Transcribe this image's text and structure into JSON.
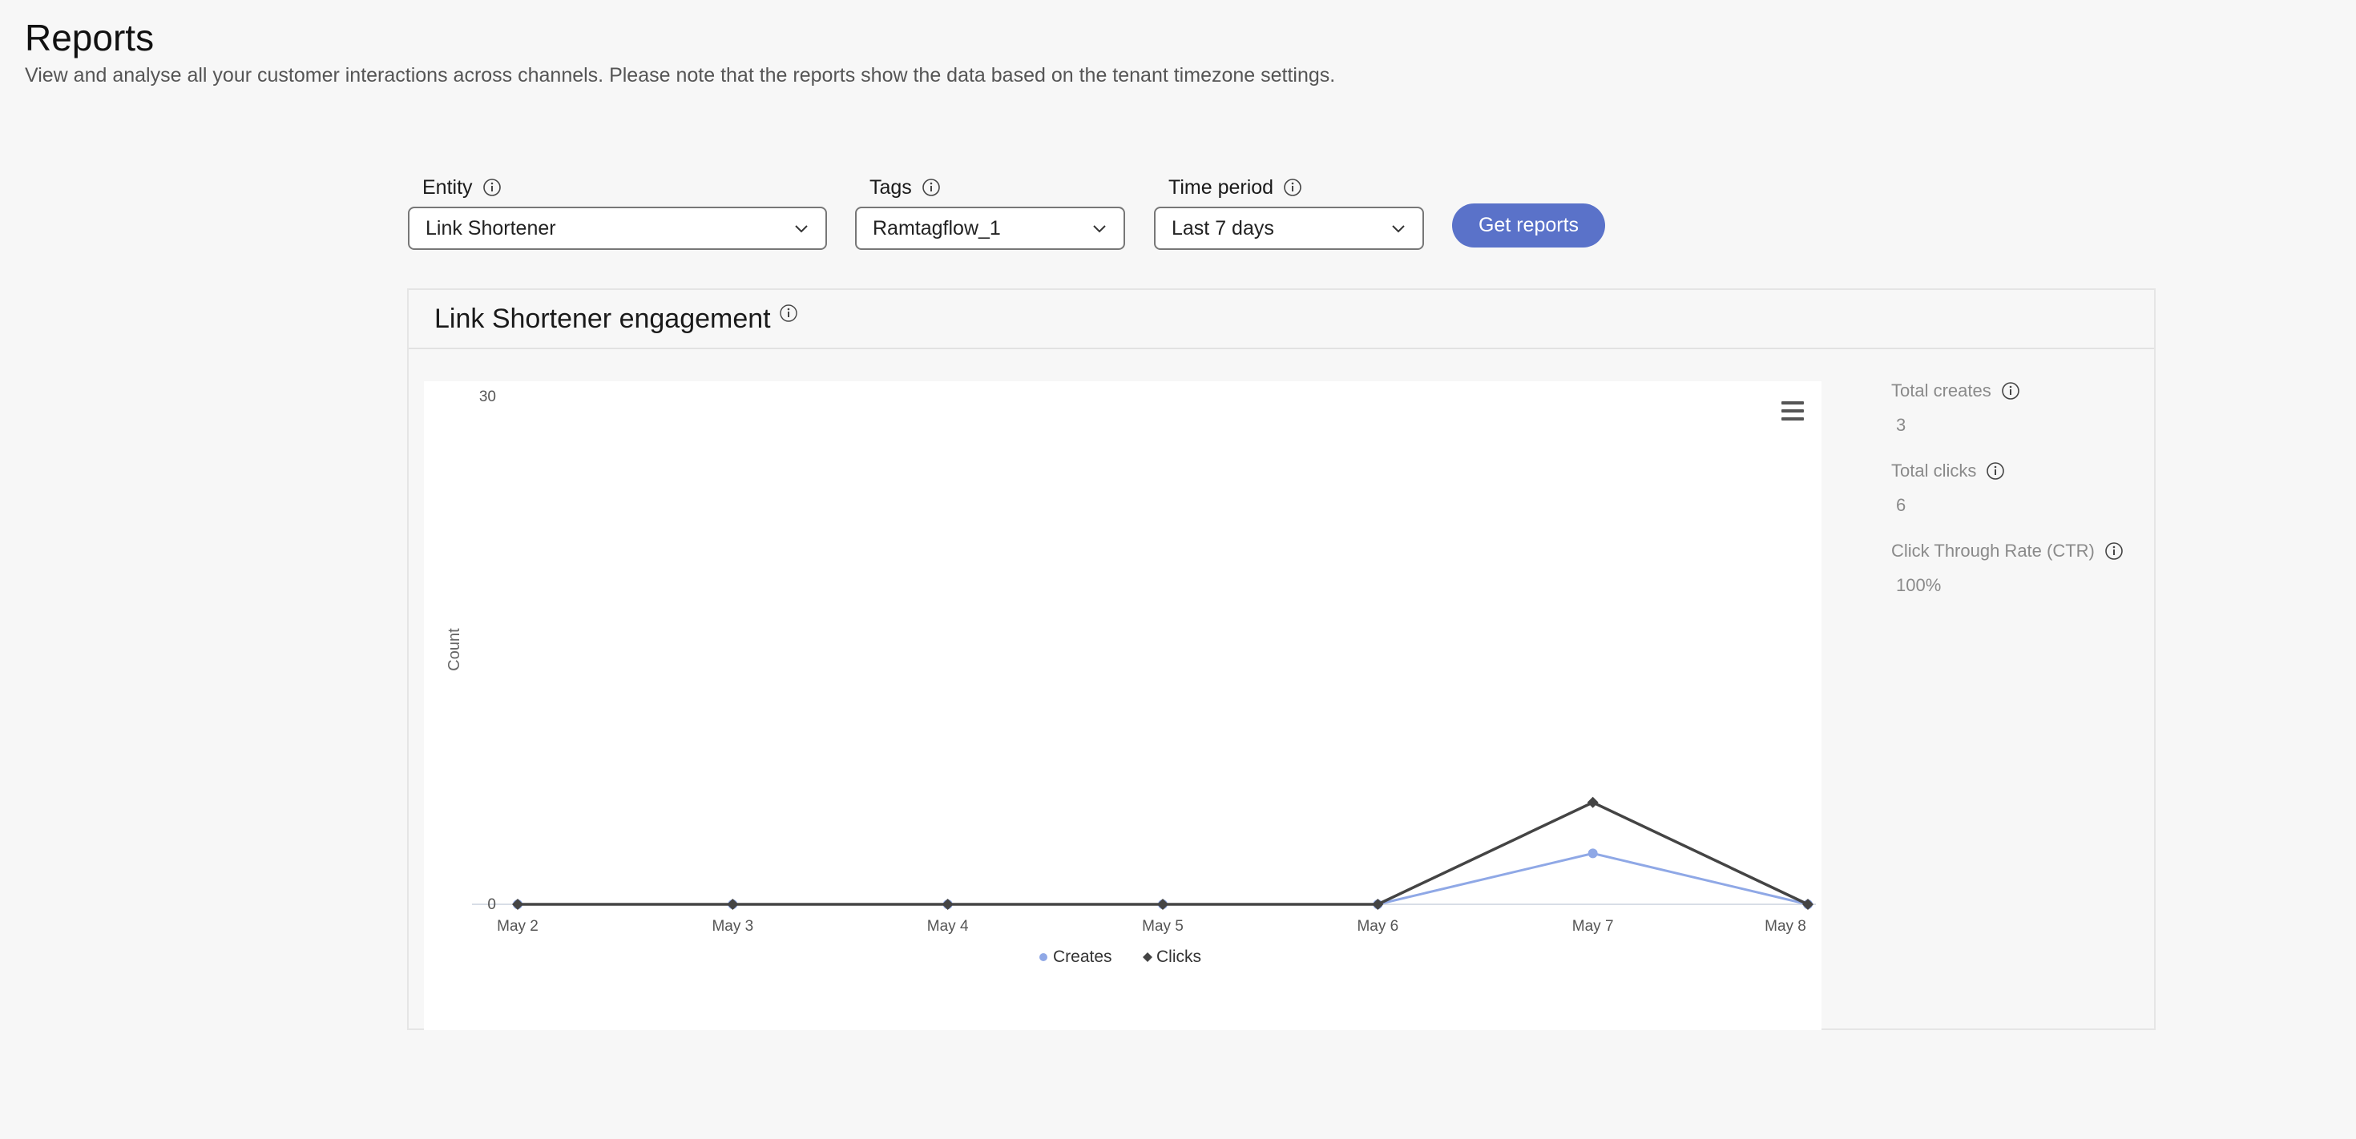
{
  "header": {
    "title": "Reports",
    "subtitle": "View and analyse all your customer interactions across channels. Please note that the reports show the data based on the tenant timezone settings."
  },
  "filters": {
    "entity": {
      "label": "Entity",
      "value": "Link Shortener"
    },
    "tags": {
      "label": "Tags",
      "value": "Ramtagflow_1"
    },
    "time_period": {
      "label": "Time period",
      "value": "Last 7 days"
    },
    "get_reports_label": "Get reports"
  },
  "panel": {
    "title": "Link Shortener engagement"
  },
  "stats": {
    "total_creates": {
      "label": "Total creates",
      "value": "3"
    },
    "total_clicks": {
      "label": "Total clicks",
      "value": "6"
    },
    "ctr": {
      "label": "Click Through Rate (CTR)",
      "value": "100%"
    }
  },
  "chart_data": {
    "type": "line",
    "categories": [
      "May 2",
      "May 3",
      "May 4",
      "May 5",
      "May 6",
      "May 7",
      "May 8"
    ],
    "series": [
      {
        "name": "Creates",
        "values": [
          0,
          0,
          0,
          0,
          0,
          3,
          0
        ],
        "color": "#8fa8e6"
      },
      {
        "name": "Clicks",
        "values": [
          0,
          0,
          0,
          0,
          0,
          6,
          0
        ],
        "color": "#444444"
      }
    ],
    "ylabel": "Count",
    "ylim": [
      0,
      30
    ],
    "yticks": [
      "0",
      "30"
    ],
    "legend_position": "bottom-center",
    "grid": false
  },
  "colors": {
    "accent": "#5a72c9",
    "background": "#f7f7f7"
  }
}
